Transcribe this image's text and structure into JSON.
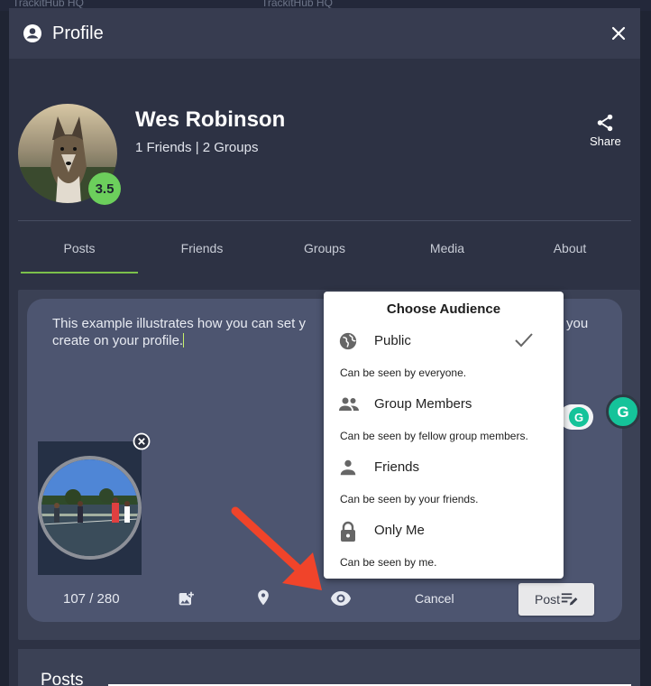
{
  "background": {
    "hub_left": "TrackitHub HQ",
    "hub_right": "TrackitHub HQ"
  },
  "modal": {
    "title": "Profile",
    "close_icon": "close-icon"
  },
  "profile": {
    "name": "Wes Robinson",
    "stats": "1 Friends | 2 Groups",
    "rating": "3.5",
    "rating_color": "#6ccf5c",
    "share_label": "Share"
  },
  "tabs": [
    {
      "label": "Posts",
      "active": true
    },
    {
      "label": "Friends",
      "active": false
    },
    {
      "label": "Groups",
      "active": false
    },
    {
      "label": "Media",
      "active": false
    },
    {
      "label": "About",
      "active": false
    }
  ],
  "composer": {
    "text_line1": "This example illustrates how you can set y",
    "text_line1_tail": "you",
    "text_line2": "create on your profile.",
    "counter": "107 / 280",
    "cancel_label": "Cancel",
    "post_label": "Post"
  },
  "audience_menu": {
    "title": "Choose Audience",
    "selected": "Public",
    "options": [
      {
        "label": "Public",
        "description": "Can be seen by everyone.",
        "icon": "globe-icon"
      },
      {
        "label": "Group Members",
        "description": "Can be seen by fellow group members.",
        "icon": "group-icon"
      },
      {
        "label": "Friends",
        "description": "Can be seen by your friends.",
        "icon": "person-icon"
      },
      {
        "label": "Only Me",
        "description": "Can be seen by me.",
        "icon": "lock-icon"
      }
    ]
  },
  "posts_section": {
    "title": "Posts"
  },
  "colors": {
    "accent": "#7cc04b",
    "arrow": "#f0442a",
    "grammarly": "#15c39a"
  }
}
